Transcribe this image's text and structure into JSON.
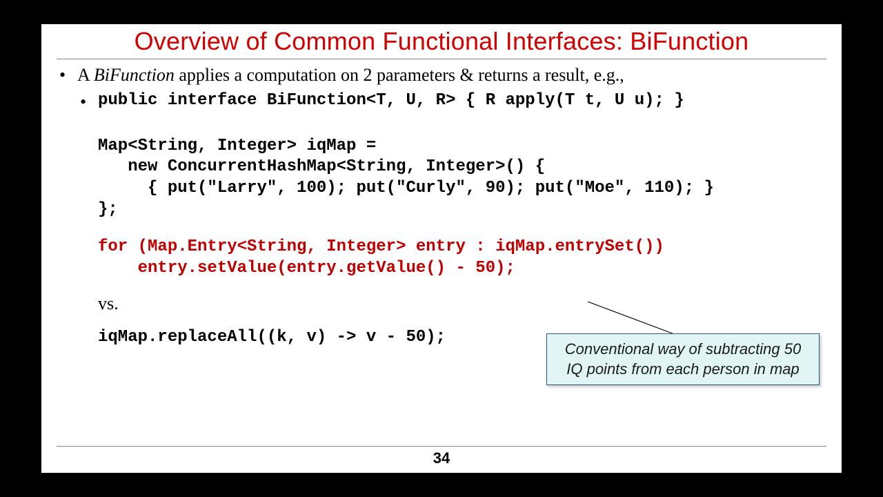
{
  "title": "Overview of Common Functional Interfaces: BiFunction",
  "bullet1": {
    "prefix": "A ",
    "emphasis": "BiFunction",
    "suffix": " applies a computation on 2 parameters & returns a result, e.g.,"
  },
  "bullet2": "public interface BiFunction<T, U, R> { R apply(T t, U u); }",
  "code_map": "Map<String, Integer> iqMap =\n   new ConcurrentHashMap<String, Integer>() {\n     { put(\"Larry\", 100); put(\"Curly\", 90); put(\"Moe\", 110); }\n};",
  "code_for": "for (Map.Entry<String, Integer> entry : iqMap.entrySet())\n    entry.setValue(entry.getValue() - 50);",
  "vs_label": "vs.",
  "code_replace": "iqMap.replaceAll((k, v) -> v - 50);",
  "callout": "Conventional way of subtracting 50 IQ points from each person in map",
  "page_number": "34"
}
